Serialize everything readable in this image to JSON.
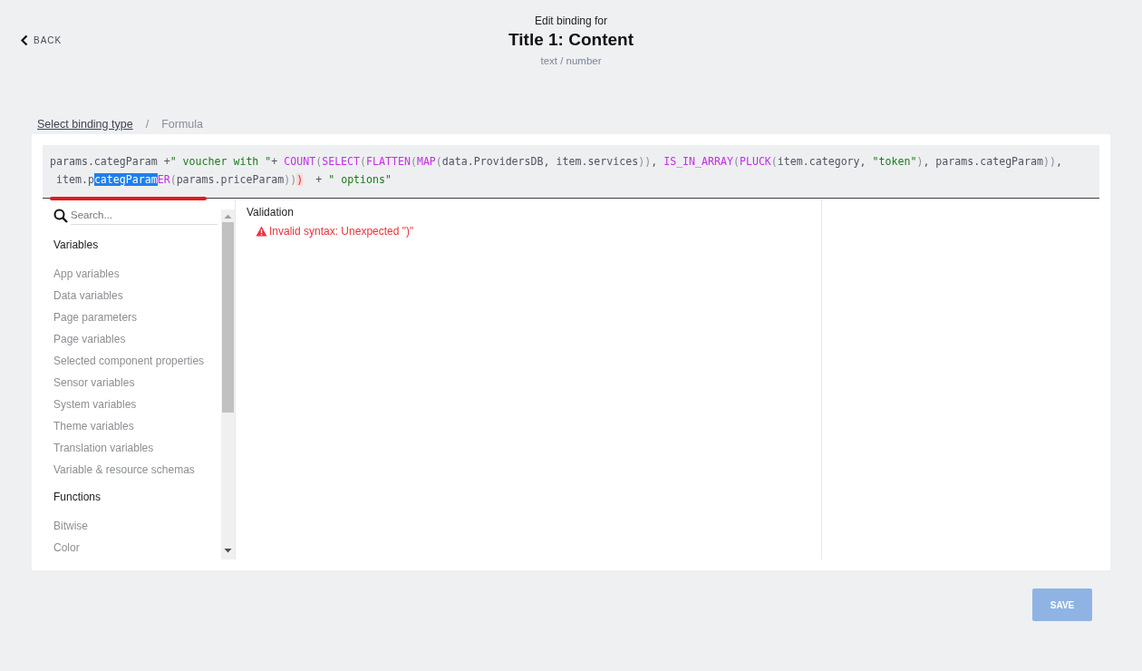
{
  "header": {
    "back": "BACK",
    "subtitle": "Edit binding for",
    "title": "Title 1: Content",
    "type": "text / number"
  },
  "breadcrumb": {
    "link": "Select binding type",
    "separator": "/",
    "current": "Formula"
  },
  "editor": {
    "lines": [
      [
        {
          "kind": "text",
          "text": "params.categParam +"
        },
        {
          "kind": "string",
          "text": "\" voucher with \""
        },
        {
          "kind": "text",
          "text": "+ "
        },
        {
          "kind": "func",
          "text": "COUNT"
        },
        {
          "kind": "paren",
          "text": "("
        },
        {
          "kind": "func",
          "text": "SELECT"
        },
        {
          "kind": "paren",
          "text": "("
        },
        {
          "kind": "func",
          "text": "FLATTEN"
        },
        {
          "kind": "paren",
          "text": "("
        },
        {
          "kind": "func",
          "text": "MAP"
        },
        {
          "kind": "paren",
          "text": "("
        },
        {
          "kind": "text",
          "text": "data.ProvidersDB, item.services"
        },
        {
          "kind": "paren",
          "text": "))"
        },
        {
          "kind": "text",
          "text": ", "
        },
        {
          "kind": "func",
          "text": "IS_IN_ARRAY"
        },
        {
          "kind": "paren",
          "text": "("
        },
        {
          "kind": "func",
          "text": "PLUCK"
        },
        {
          "kind": "paren",
          "text": "("
        },
        {
          "kind": "text",
          "text": "item.category, "
        },
        {
          "kind": "string",
          "text": "\"token\""
        },
        {
          "kind": "paren",
          "text": ")"
        },
        {
          "kind": "text",
          "text": ", params.categParam"
        },
        {
          "kind": "paren",
          "text": "))"
        },
        {
          "kind": "text",
          "text": ","
        }
      ],
      [
        {
          "kind": "text",
          "text": " item.p"
        },
        {
          "kind": "selection",
          "text": "categParam"
        },
        {
          "kind": "func",
          "text": "ER"
        },
        {
          "kind": "paren",
          "text": "("
        },
        {
          "kind": "text",
          "text": "params.priceParam"
        },
        {
          "kind": "paren",
          "text": "))"
        },
        {
          "kind": "error",
          "text": ")"
        },
        {
          "kind": "text",
          "text": "  + "
        },
        {
          "kind": "string",
          "text": "\" options\""
        }
      ]
    ]
  },
  "sidebar": {
    "search": {
      "placeholder": "Search..."
    },
    "items": [
      {
        "kind": "header",
        "label": "Variables"
      },
      {
        "kind": "item",
        "label": "App variables"
      },
      {
        "kind": "item",
        "label": "Data variables"
      },
      {
        "kind": "item",
        "label": "Page parameters"
      },
      {
        "kind": "item",
        "label": "Page variables"
      },
      {
        "kind": "item",
        "label": "Selected component properties"
      },
      {
        "kind": "item",
        "label": "Sensor variables"
      },
      {
        "kind": "item",
        "label": "System variables"
      },
      {
        "kind": "item",
        "label": "Theme variables"
      },
      {
        "kind": "item",
        "label": "Translation variables"
      },
      {
        "kind": "item",
        "label": "Variable & resource schemas"
      },
      {
        "kind": "header",
        "label": "Functions"
      },
      {
        "kind": "item",
        "label": "Bitwise"
      },
      {
        "kind": "item",
        "label": "Color"
      }
    ]
  },
  "validation": {
    "title": "Validation",
    "messages": [
      "Invalid syntax: Unexpected \")\""
    ]
  },
  "save": {
    "label": "SAVE",
    "disabled": true
  }
}
